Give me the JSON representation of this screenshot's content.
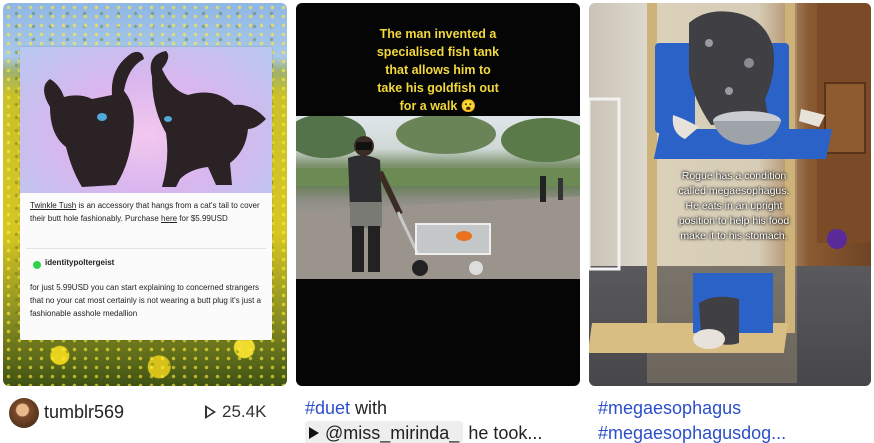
{
  "cards": [
    {
      "tumblr_post": {
        "caption_link": "Twinkle Tush",
        "caption_text": " is an accessory that hangs from a cat's tail to cover their butt hole fashionably. Purchase ",
        "caption_link2": "here",
        "caption_tail": " for $5.99USD",
        "reply_user": "identitypoltergeist",
        "reply_text": "for just 5.99USD you can start explaining to concerned strangers that no your cat most certainly is not wearing a butt plug it's just a fashionable asshole medallion"
      },
      "author": "tumblr569",
      "views": "25.4K"
    },
    {
      "overlay_text_lines": [
        "The man invented a",
        "specialised fish tank",
        "that allows him to",
        "take his goldfish out",
        "for a walk 😮"
      ],
      "description": {
        "hashtag": "#duet",
        "text_after_hashtag": " with",
        "mention": "@miss_mirinda_",
        "tail": " he took..."
      }
    },
    {
      "overlay_text_lines": [
        "Rogue has a condition",
        "called megaesophagus.",
        "He eats in an upright",
        "position to help his food",
        "make it to his stomach."
      ],
      "description": {
        "hashtags": [
          "#megaesophagus",
          "#megaesophagusdog..."
        ]
      }
    }
  ],
  "colors": {
    "hashtag": "#2b4fc9",
    "overlay_yellow": "#f2d83b",
    "chair_blue": "#2a62c8",
    "online_dot": "#2fd24a"
  },
  "icons": {
    "views": "play-outline-icon",
    "mention": "play-filled-icon"
  }
}
